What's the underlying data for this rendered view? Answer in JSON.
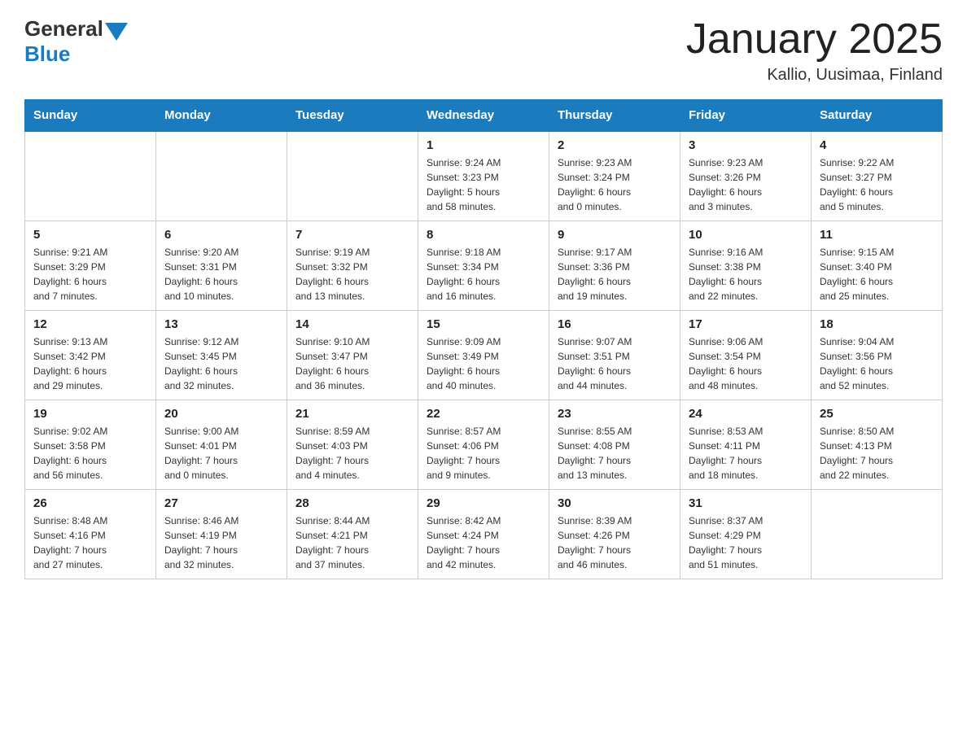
{
  "header": {
    "logo_general": "General",
    "logo_blue": "Blue",
    "month_title": "January 2025",
    "location": "Kallio, Uusimaa, Finland"
  },
  "days_of_week": [
    "Sunday",
    "Monday",
    "Tuesday",
    "Wednesday",
    "Thursday",
    "Friday",
    "Saturday"
  ],
  "weeks": [
    [
      {
        "day": "",
        "info": ""
      },
      {
        "day": "",
        "info": ""
      },
      {
        "day": "",
        "info": ""
      },
      {
        "day": "1",
        "info": "Sunrise: 9:24 AM\nSunset: 3:23 PM\nDaylight: 5 hours\nand 58 minutes."
      },
      {
        "day": "2",
        "info": "Sunrise: 9:23 AM\nSunset: 3:24 PM\nDaylight: 6 hours\nand 0 minutes."
      },
      {
        "day": "3",
        "info": "Sunrise: 9:23 AM\nSunset: 3:26 PM\nDaylight: 6 hours\nand 3 minutes."
      },
      {
        "day": "4",
        "info": "Sunrise: 9:22 AM\nSunset: 3:27 PM\nDaylight: 6 hours\nand 5 minutes."
      }
    ],
    [
      {
        "day": "5",
        "info": "Sunrise: 9:21 AM\nSunset: 3:29 PM\nDaylight: 6 hours\nand 7 minutes."
      },
      {
        "day": "6",
        "info": "Sunrise: 9:20 AM\nSunset: 3:31 PM\nDaylight: 6 hours\nand 10 minutes."
      },
      {
        "day": "7",
        "info": "Sunrise: 9:19 AM\nSunset: 3:32 PM\nDaylight: 6 hours\nand 13 minutes."
      },
      {
        "day": "8",
        "info": "Sunrise: 9:18 AM\nSunset: 3:34 PM\nDaylight: 6 hours\nand 16 minutes."
      },
      {
        "day": "9",
        "info": "Sunrise: 9:17 AM\nSunset: 3:36 PM\nDaylight: 6 hours\nand 19 minutes."
      },
      {
        "day": "10",
        "info": "Sunrise: 9:16 AM\nSunset: 3:38 PM\nDaylight: 6 hours\nand 22 minutes."
      },
      {
        "day": "11",
        "info": "Sunrise: 9:15 AM\nSunset: 3:40 PM\nDaylight: 6 hours\nand 25 minutes."
      }
    ],
    [
      {
        "day": "12",
        "info": "Sunrise: 9:13 AM\nSunset: 3:42 PM\nDaylight: 6 hours\nand 29 minutes."
      },
      {
        "day": "13",
        "info": "Sunrise: 9:12 AM\nSunset: 3:45 PM\nDaylight: 6 hours\nand 32 minutes."
      },
      {
        "day": "14",
        "info": "Sunrise: 9:10 AM\nSunset: 3:47 PM\nDaylight: 6 hours\nand 36 minutes."
      },
      {
        "day": "15",
        "info": "Sunrise: 9:09 AM\nSunset: 3:49 PM\nDaylight: 6 hours\nand 40 minutes."
      },
      {
        "day": "16",
        "info": "Sunrise: 9:07 AM\nSunset: 3:51 PM\nDaylight: 6 hours\nand 44 minutes."
      },
      {
        "day": "17",
        "info": "Sunrise: 9:06 AM\nSunset: 3:54 PM\nDaylight: 6 hours\nand 48 minutes."
      },
      {
        "day": "18",
        "info": "Sunrise: 9:04 AM\nSunset: 3:56 PM\nDaylight: 6 hours\nand 52 minutes."
      }
    ],
    [
      {
        "day": "19",
        "info": "Sunrise: 9:02 AM\nSunset: 3:58 PM\nDaylight: 6 hours\nand 56 minutes."
      },
      {
        "day": "20",
        "info": "Sunrise: 9:00 AM\nSunset: 4:01 PM\nDaylight: 7 hours\nand 0 minutes."
      },
      {
        "day": "21",
        "info": "Sunrise: 8:59 AM\nSunset: 4:03 PM\nDaylight: 7 hours\nand 4 minutes."
      },
      {
        "day": "22",
        "info": "Sunrise: 8:57 AM\nSunset: 4:06 PM\nDaylight: 7 hours\nand 9 minutes."
      },
      {
        "day": "23",
        "info": "Sunrise: 8:55 AM\nSunset: 4:08 PM\nDaylight: 7 hours\nand 13 minutes."
      },
      {
        "day": "24",
        "info": "Sunrise: 8:53 AM\nSunset: 4:11 PM\nDaylight: 7 hours\nand 18 minutes."
      },
      {
        "day": "25",
        "info": "Sunrise: 8:50 AM\nSunset: 4:13 PM\nDaylight: 7 hours\nand 22 minutes."
      }
    ],
    [
      {
        "day": "26",
        "info": "Sunrise: 8:48 AM\nSunset: 4:16 PM\nDaylight: 7 hours\nand 27 minutes."
      },
      {
        "day": "27",
        "info": "Sunrise: 8:46 AM\nSunset: 4:19 PM\nDaylight: 7 hours\nand 32 minutes."
      },
      {
        "day": "28",
        "info": "Sunrise: 8:44 AM\nSunset: 4:21 PM\nDaylight: 7 hours\nand 37 minutes."
      },
      {
        "day": "29",
        "info": "Sunrise: 8:42 AM\nSunset: 4:24 PM\nDaylight: 7 hours\nand 42 minutes."
      },
      {
        "day": "30",
        "info": "Sunrise: 8:39 AM\nSunset: 4:26 PM\nDaylight: 7 hours\nand 46 minutes."
      },
      {
        "day": "31",
        "info": "Sunrise: 8:37 AM\nSunset: 4:29 PM\nDaylight: 7 hours\nand 51 minutes."
      },
      {
        "day": "",
        "info": ""
      }
    ]
  ]
}
